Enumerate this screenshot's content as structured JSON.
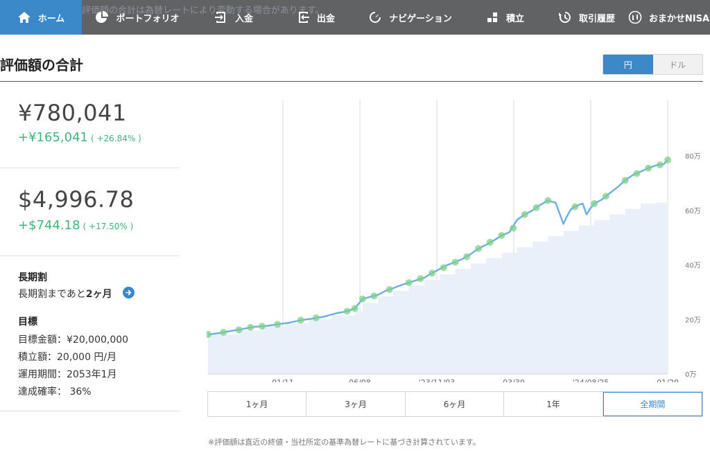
{
  "nav": {
    "ghost_text": "評価額の合計は為替レートにより変動する場合があります。",
    "items": [
      {
        "label": "ホーム",
        "icon": "home-icon",
        "active": true
      },
      {
        "label": "ポートフォリオ",
        "icon": "pie-chart-icon",
        "active": false
      },
      {
        "label": "入金",
        "icon": "deposit-icon",
        "active": false
      },
      {
        "label": "出金",
        "icon": "withdraw-icon",
        "active": false
      },
      {
        "label": "ナビゲーション",
        "icon": "navigation-icon",
        "active": false
      },
      {
        "label": "積立",
        "icon": "accumulation-icon",
        "active": false
      },
      {
        "label": "取引履歴",
        "icon": "history-icon",
        "active": false
      },
      {
        "label": "おまかせNISA",
        "icon": "nisa-icon",
        "active": false
      }
    ]
  },
  "header": {
    "title": "評価額の合計",
    "currency": {
      "jpy": "円",
      "usd": "ドル",
      "selected": "jpy"
    }
  },
  "summary": {
    "jpy_total": "¥780,041",
    "jpy_gain": "+¥165,041",
    "jpy_gain_pct": "( +26.84% )",
    "usd_total": "$4,996.78",
    "usd_gain": "+$744.18",
    "usd_gain_pct": "( +17.50% )"
  },
  "long_term": {
    "heading": "長期割",
    "text_prefix": "長期割まであと",
    "text_bold": "2ヶ月"
  },
  "goal": {
    "heading": "目標",
    "rows": [
      "目標金額：¥20,000,000",
      "積立額：20,000 円/月",
      "運用期間：2053年1月",
      "達成確率： 36%"
    ]
  },
  "periods": {
    "options": [
      "1ヶ月",
      "3ヶ月",
      "6ヶ月",
      "1年",
      "全期間"
    ],
    "selected": "全期間"
  },
  "footnote": "※評価額は直近の終値・当社所定の基準為替レートに基づき計算されています。",
  "colors": {
    "accent": "#3a87c9",
    "gain": "#3cb779",
    "nav_bg": "#5f6366",
    "line": "#6aade4",
    "area": "#e9f0f8",
    "marker": "#7cd08a"
  },
  "chart_data": {
    "type": "line",
    "x_ticks": [
      "01/11",
      "06/08",
      "'23/11/03",
      "03/30",
      "'24/08/25",
      "01/20"
    ],
    "y_ticks": [
      {
        "value": 0,
        "label": "0万"
      },
      {
        "value": 20,
        "label": "20万"
      },
      {
        "value": 40,
        "label": "40万"
      },
      {
        "value": 60,
        "label": "60万"
      },
      {
        "value": 80,
        "label": "80万"
      }
    ],
    "ylim": [
      0,
      80
    ],
    "y_unit": "万円",
    "series": [
      {
        "kind": "valuation",
        "points": [
          [
            0,
            14.5
          ],
          [
            3,
            15
          ],
          [
            6,
            15.8
          ],
          [
            9,
            16.5
          ],
          [
            12,
            17.3
          ],
          [
            15,
            17.6
          ],
          [
            18,
            18.2
          ],
          [
            21,
            18.8
          ],
          [
            24,
            19.7
          ],
          [
            27,
            20.3
          ],
          [
            30,
            21.0
          ],
          [
            33,
            22.2
          ],
          [
            36,
            23.0
          ],
          [
            38,
            24.0
          ],
          [
            40,
            27.5
          ],
          [
            42,
            28.3
          ],
          [
            44,
            29.0
          ],
          [
            46,
            30.5
          ],
          [
            48,
            31.5
          ],
          [
            50,
            32.6
          ],
          [
            52,
            33.5
          ],
          [
            54,
            34.4
          ],
          [
            56,
            35.3
          ],
          [
            58,
            37.0
          ],
          [
            60,
            38.5
          ],
          [
            62,
            40.0
          ],
          [
            64,
            41.0
          ],
          [
            66,
            42.3
          ],
          [
            68,
            44.0
          ],
          [
            70,
            46.0
          ],
          [
            72,
            47.4
          ],
          [
            74,
            49.0
          ],
          [
            76,
            50.8
          ],
          [
            78,
            52.0
          ],
          [
            80,
            56.5
          ],
          [
            82,
            58.5
          ],
          [
            84,
            60.0
          ],
          [
            86,
            62.0
          ],
          [
            88,
            63.6
          ],
          [
            90,
            62.8
          ],
          [
            92,
            55.0
          ],
          [
            93,
            58.0
          ],
          [
            94,
            60.5
          ],
          [
            95,
            61.3
          ],
          [
            96,
            62.0
          ],
          [
            97,
            62.5
          ],
          [
            98,
            58.5
          ],
          [
            99,
            60.8
          ],
          [
            100,
            62.5
          ],
          [
            102,
            64.0
          ],
          [
            104,
            66.3
          ],
          [
            106,
            68.5
          ],
          [
            108,
            71.0
          ],
          [
            110,
            73.0
          ],
          [
            112,
            74.2
          ],
          [
            114,
            75.5
          ],
          [
            116,
            76.5
          ],
          [
            118,
            77.0
          ],
          [
            119,
            78.5
          ]
        ]
      },
      {
        "kind": "contribution",
        "steps": [
          [
            0,
            14.5
          ],
          [
            8,
            16
          ],
          [
            14,
            17.5
          ],
          [
            20,
            18.5
          ],
          [
            26,
            20
          ],
          [
            32,
            21.5
          ],
          [
            38,
            23
          ],
          [
            40,
            26
          ],
          [
            44,
            28.5
          ],
          [
            48,
            30.5
          ],
          [
            52,
            32.5
          ],
          [
            56,
            34.5
          ],
          [
            60,
            36.5
          ],
          [
            64,
            38.5
          ],
          [
            68,
            40.5
          ],
          [
            72,
            42.5
          ],
          [
            76,
            44.5
          ],
          [
            80,
            46.5
          ],
          [
            84,
            48.5
          ],
          [
            88,
            50.5
          ],
          [
            92,
            52.5
          ],
          [
            96,
            54.5
          ],
          [
            100,
            56.5
          ],
          [
            104,
            58.5
          ],
          [
            108,
            60.5
          ],
          [
            112,
            62.5
          ],
          [
            116,
            62.8
          ],
          [
            119,
            64
          ]
        ]
      }
    ],
    "markers": [
      [
        0,
        14.5
      ],
      [
        4,
        15.3
      ],
      [
        8,
        16.2
      ],
      [
        11,
        17.1
      ],
      [
        14,
        17.5
      ],
      [
        18,
        18.2
      ],
      [
        24,
        19.7
      ],
      [
        28,
        20.6
      ],
      [
        36,
        23.0
      ],
      [
        38,
        24.0
      ],
      [
        40,
        27.5
      ],
      [
        43,
        28.6
      ],
      [
        47,
        31.0
      ],
      [
        52,
        33.5
      ],
      [
        55,
        35.0
      ],
      [
        58,
        37.0
      ],
      [
        61,
        39.0
      ],
      [
        64,
        41.0
      ],
      [
        67,
        43.0
      ],
      [
        70,
        46.0
      ],
      [
        73,
        48.3
      ],
      [
        76,
        50.8
      ],
      [
        79,
        53.5
      ],
      [
        82,
        58.5
      ],
      [
        85,
        61.0
      ],
      [
        88,
        63.6
      ],
      [
        95,
        61.3
      ],
      [
        100,
        62.5
      ],
      [
        103,
        65.2
      ],
      [
        108,
        71.0
      ],
      [
        111,
        73.5
      ],
      [
        114,
        75.5
      ],
      [
        117,
        76.7
      ],
      [
        119,
        78.5
      ]
    ],
    "x_range": [
      0,
      119
    ],
    "grid": "vertical"
  }
}
